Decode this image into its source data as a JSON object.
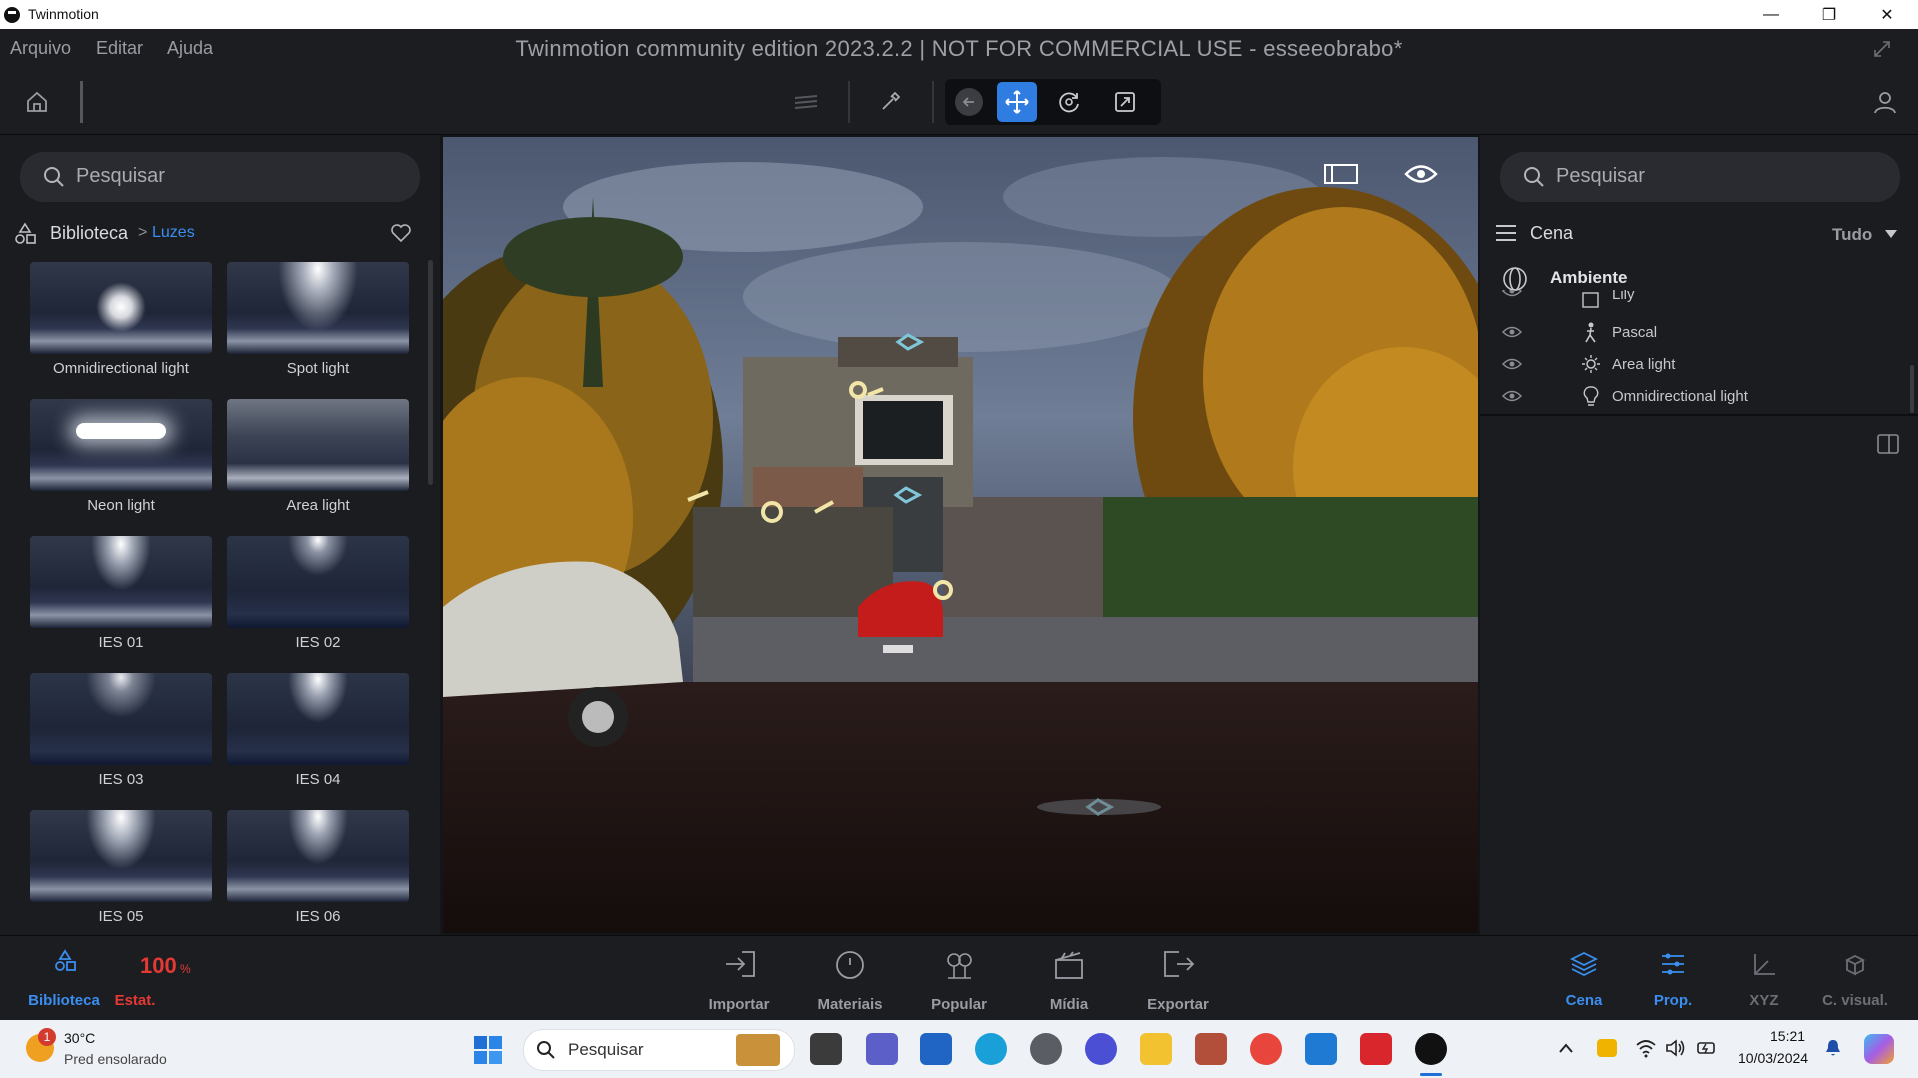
{
  "window": {
    "app_name": "Twinmotion",
    "minimize": "—",
    "maximize": "❐",
    "close": "✕"
  },
  "menu": {
    "items": [
      "Arquivo",
      "Editar",
      "Ajuda"
    ],
    "doc_title": "Twinmotion community edition 2023.2.2 | NOT FOR COMMERCIAL USE - esseeobrabo*"
  },
  "library": {
    "search_placeholder": "Pesquisar",
    "breadcrumb_root": "Biblioteca",
    "breadcrumb_separator": ">",
    "breadcrumb_current": "Luzes",
    "items": [
      {
        "label": "Omnidirectional light"
      },
      {
        "label": "Spot light"
      },
      {
        "label": "Neon light"
      },
      {
        "label": "Area light"
      },
      {
        "label": "IES 01"
      },
      {
        "label": "IES 02"
      },
      {
        "label": "IES 03"
      },
      {
        "label": "IES 04"
      },
      {
        "label": "IES 05"
      },
      {
        "label": "IES 06"
      }
    ]
  },
  "scene": {
    "search_placeholder": "Pesquisar",
    "title": "Cena",
    "filter": "Tudo",
    "root": "Ambiente",
    "items": [
      {
        "label": "Lily",
        "icon": "box-icon"
      },
      {
        "label": "Pascal",
        "icon": "person-walk-icon"
      },
      {
        "label": "Area light",
        "icon": "sun-icon"
      },
      {
        "label": "Omnidirectional light",
        "icon": "bulb-icon"
      }
    ]
  },
  "bottom": {
    "left": [
      {
        "label": "Biblioteca"
      },
      {
        "label": "Estat.",
        "value": "100",
        "unit": "%"
      }
    ],
    "center": [
      {
        "label": "Importar"
      },
      {
        "label": "Materiais"
      },
      {
        "label": "Popular"
      },
      {
        "label": "Mídia"
      },
      {
        "label": "Exportar"
      }
    ],
    "right": [
      {
        "label": "Cena"
      },
      {
        "label": "Prop."
      },
      {
        "label": "XYZ"
      },
      {
        "label": "C. visual."
      }
    ]
  },
  "taskbar": {
    "weather_temp": "30°C",
    "weather_desc": "Pred ensolarado",
    "weather_badge": "1",
    "search_placeholder": "Pesquisar",
    "time": "15:21",
    "date": "10/03/2024"
  },
  "colors": {
    "accent": "#2f7de1",
    "stat_red": "#e53935",
    "panel": "#1b1c20",
    "bar": "#1c1d21"
  }
}
